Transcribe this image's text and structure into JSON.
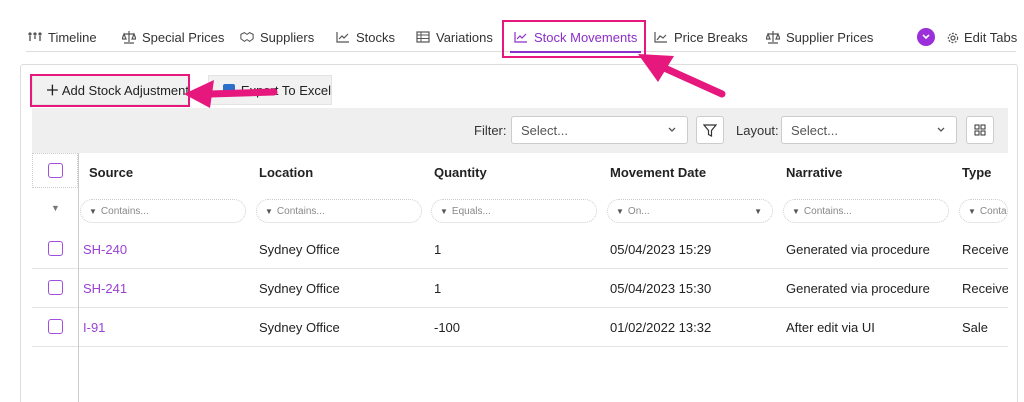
{
  "tabs": [
    {
      "label": "Timeline",
      "icon": "timeline-icon"
    },
    {
      "label": "Special Prices",
      "icon": "scale-icon"
    },
    {
      "label": "Suppliers",
      "icon": "handshake-icon"
    },
    {
      "label": "Stocks",
      "icon": "line-chart-icon"
    },
    {
      "label": "Variations",
      "icon": "table-icon"
    },
    {
      "label": "Stock Movements",
      "icon": "line-chart-icon",
      "active": true
    },
    {
      "label": "Price Breaks",
      "icon": "area-chart-icon"
    },
    {
      "label": "Supplier Prices",
      "icon": "scale-icon"
    }
  ],
  "edit_tabs_label": "Edit Tabs",
  "toolbar": {
    "add_label": "Add Stock Adjustment",
    "export_label": "Export To Excel"
  },
  "filter": {
    "label": "Filter:",
    "placeholder": "Select...",
    "layout_label": "Layout:",
    "layout_placeholder": "Select..."
  },
  "columns": [
    "Source",
    "Location",
    "Quantity",
    "Movement Date",
    "Narrative",
    "Type"
  ],
  "column_filters": [
    "Contains...",
    "Contains...",
    "Equals...",
    "On...",
    "Contains...",
    "Contains..."
  ],
  "rows": [
    {
      "source": "SH-240",
      "location": "Sydney Office",
      "quantity": "1",
      "date": "05/04/2023 15:29",
      "narrative": "Generated via procedure",
      "type": "Received"
    },
    {
      "source": "SH-241",
      "location": "Sydney Office",
      "quantity": "1",
      "date": "05/04/2023 15:30",
      "narrative": "Generated via procedure",
      "type": "Received"
    },
    {
      "source": "I-91",
      "location": "Sydney Office",
      "quantity": "-100",
      "date": "01/02/2022 13:32",
      "narrative": "After edit via UI",
      "type": "Sale"
    }
  ],
  "colors": {
    "accent": "#8b2fc9",
    "highlight": "#e6177d"
  }
}
